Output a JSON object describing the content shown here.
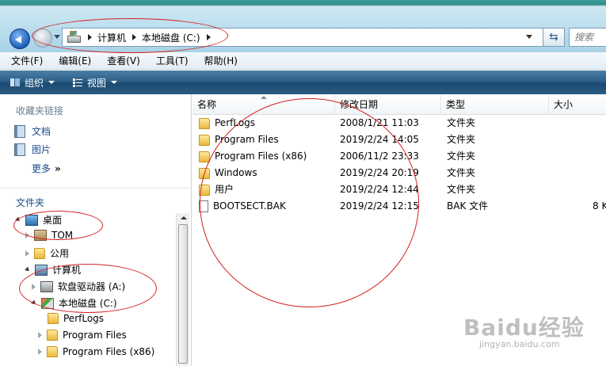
{
  "address_bar": {
    "crumbs": [
      "计算机",
      "本地磁盘 (C:)"
    ],
    "search_placeholder": "搜索"
  },
  "menu": [
    "文件(F)",
    "编辑(E)",
    "查看(V)",
    "工具(T)",
    "帮助(H)"
  ],
  "toolbar": {
    "organize_label": "组织",
    "view_label": "视图"
  },
  "nav_pane": {
    "favorites_title": "收藏夹链接",
    "favorites": [
      "文档",
      "图片"
    ],
    "more_label": "更多",
    "folders_title": "文件夹",
    "tree": [
      {
        "label": "桌面",
        "icon": "desktop-icon"
      },
      {
        "label": "TOM",
        "icon": "user-folder-icon"
      },
      {
        "label": "公用",
        "icon": "folder-icon"
      },
      {
        "label": "计算机",
        "icon": "computer-icon"
      },
      {
        "label": "软盘驱动器 (A:)",
        "icon": "floppy-drive-icon"
      },
      {
        "label": "本地磁盘 (C:)",
        "icon": "local-disk-icon"
      },
      {
        "label": "PerfLogs",
        "icon": "folder-icon"
      },
      {
        "label": "Program Files",
        "icon": "folder-icon"
      },
      {
        "label": "Program Files (x86)",
        "icon": "folder-icon"
      }
    ]
  },
  "file_list": {
    "columns": [
      "名称",
      "修改日期",
      "类型",
      "大小"
    ],
    "rows": [
      {
        "name": "PerfLogs",
        "date": "2008/1/21 11:03",
        "type": "文件夹",
        "size": "",
        "icon": "folder-icon"
      },
      {
        "name": "Program Files",
        "date": "2019/2/24 14:05",
        "type": "文件夹",
        "size": "",
        "icon": "folder-icon"
      },
      {
        "name": "Program Files (x86)",
        "date": "2006/11/2 23:33",
        "type": "文件夹",
        "size": "",
        "icon": "folder-icon"
      },
      {
        "name": "Windows",
        "date": "2019/2/24 20:19",
        "type": "文件夹",
        "size": "",
        "icon": "folder-icon"
      },
      {
        "name": "用户",
        "date": "2019/2/24 12:44",
        "type": "文件夹",
        "size": "",
        "icon": "folder-icon"
      },
      {
        "name": "BOOTSECT.BAK",
        "date": "2019/2/24 12:15",
        "type": "BAK 文件",
        "size": "8 K",
        "icon": "file-icon"
      }
    ]
  },
  "watermark": {
    "main": "Baidu经验",
    "sub": "jingyan.baidu.com"
  },
  "colors": {
    "annotation": "#d42020",
    "toolbar": "#2c5f88",
    "link": "#1a4c8a"
  }
}
